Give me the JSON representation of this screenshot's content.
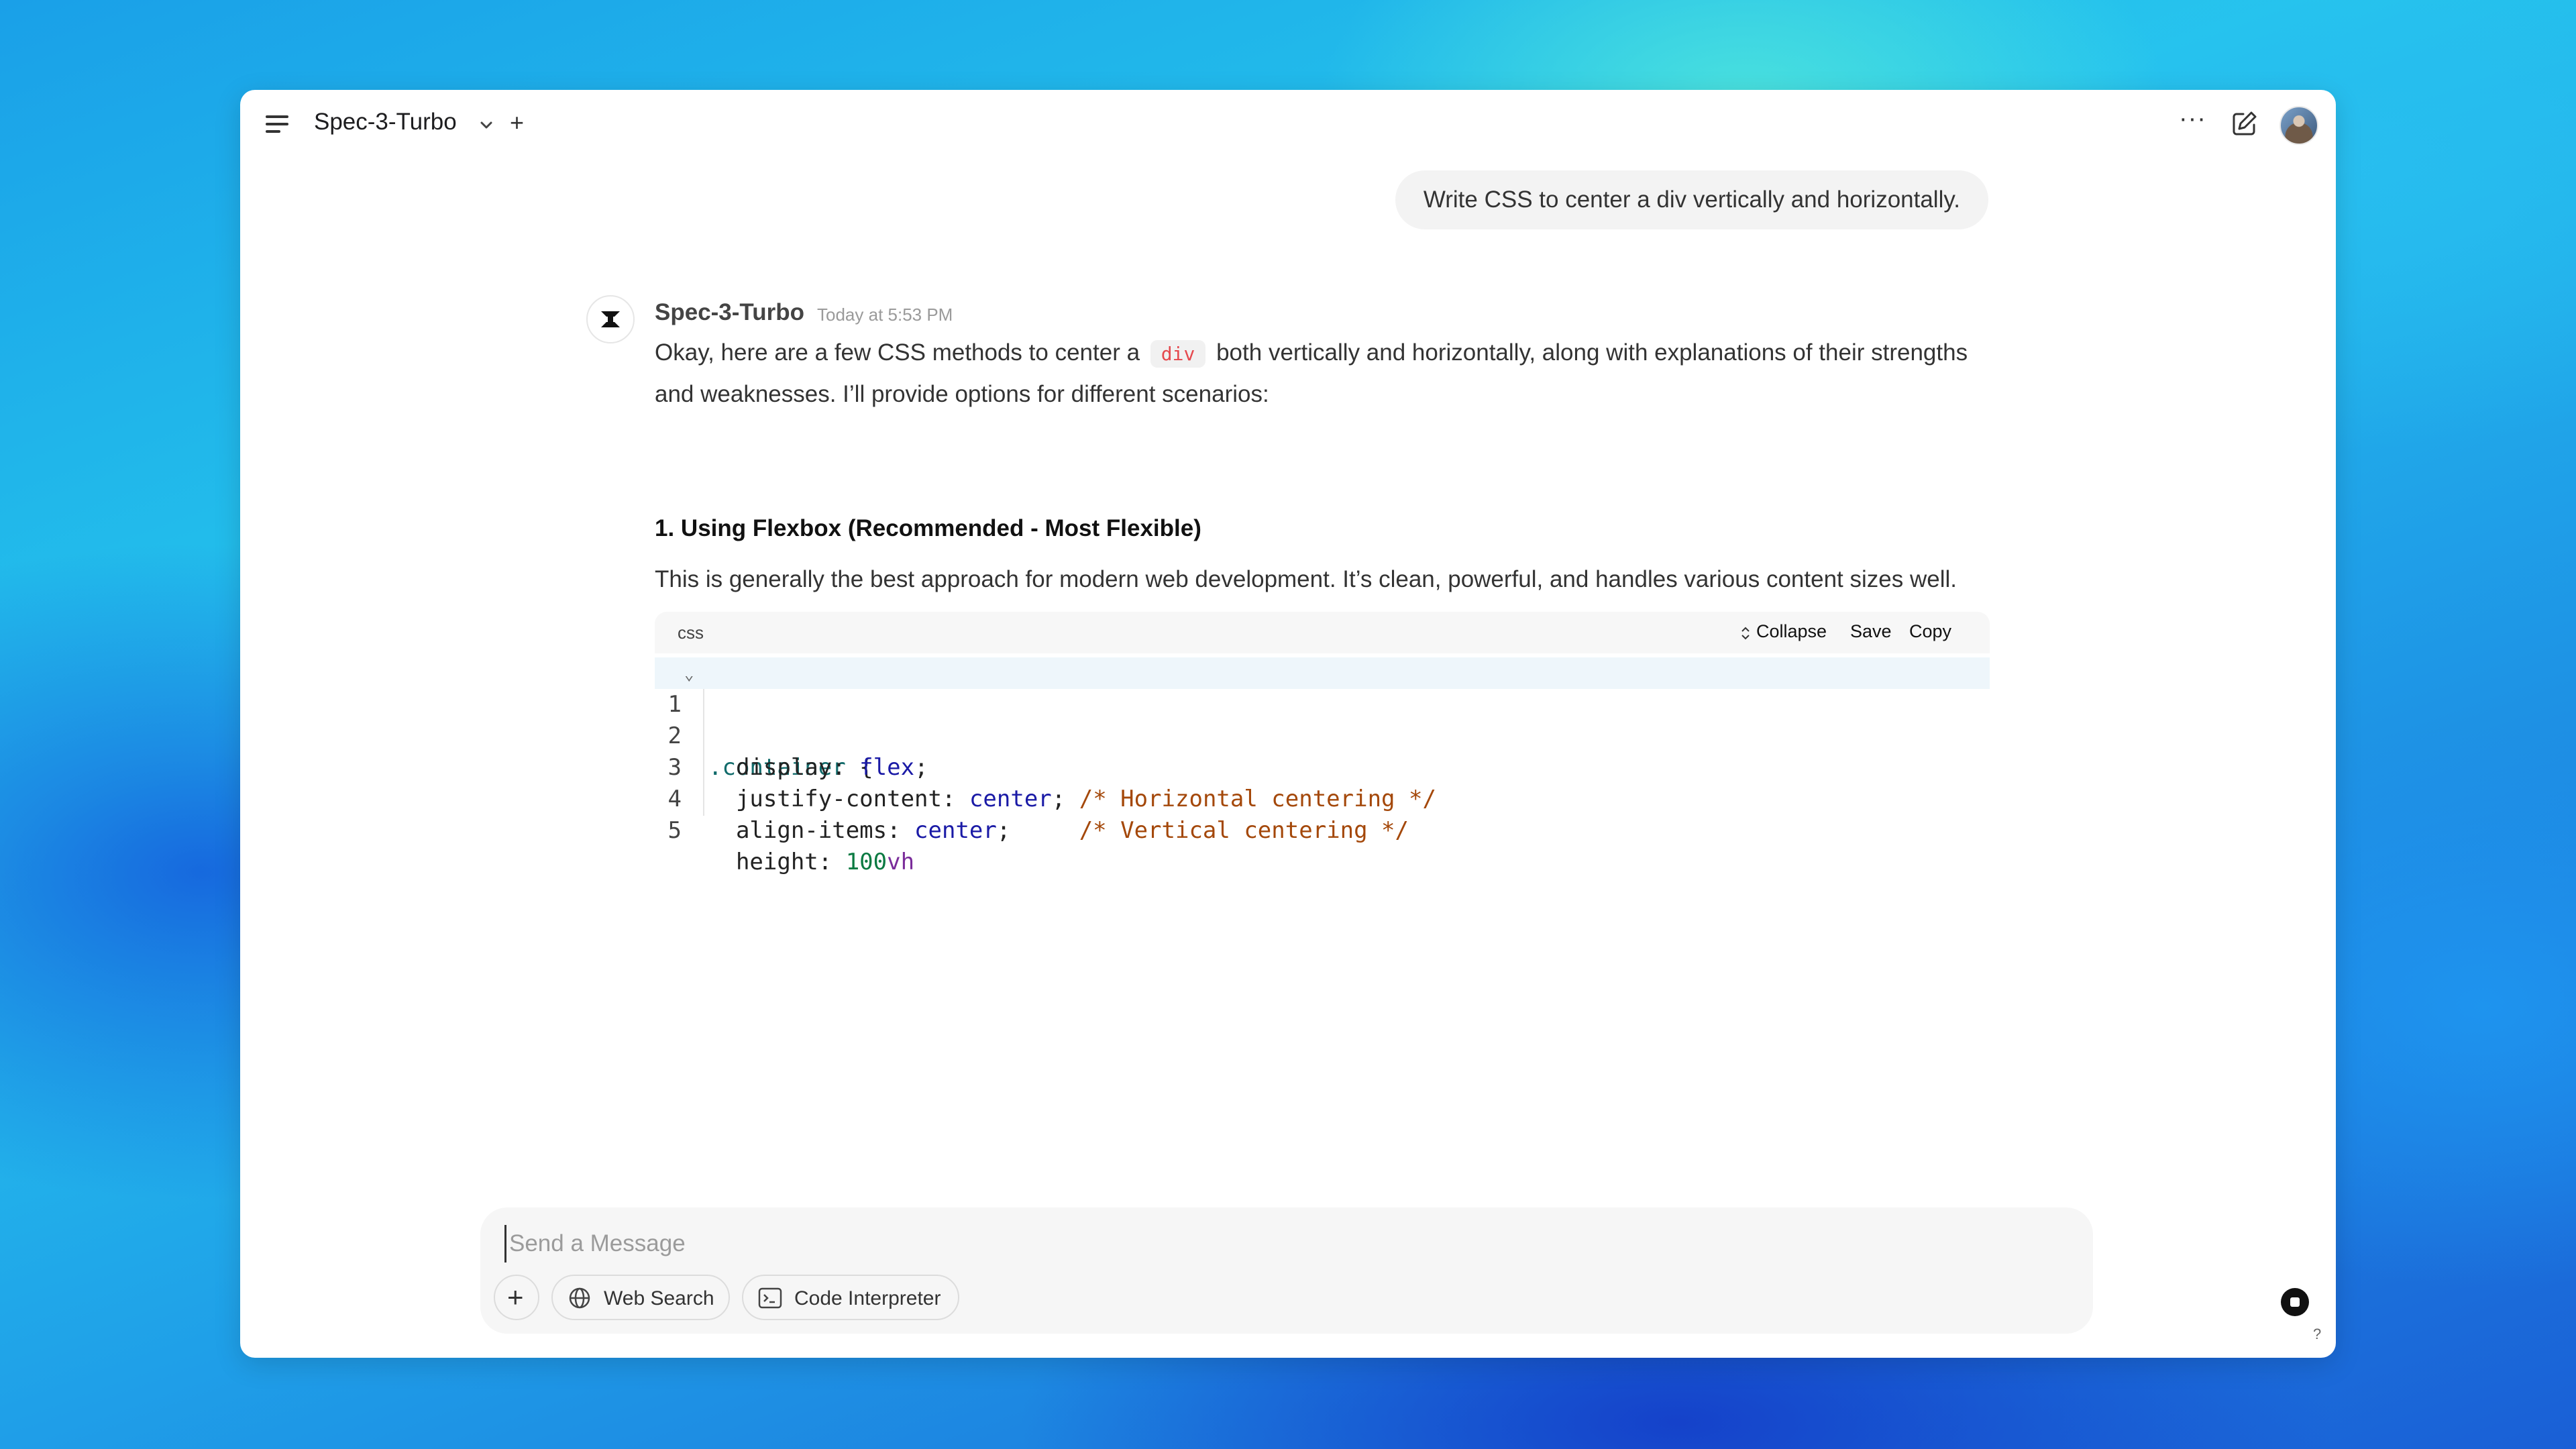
{
  "header": {
    "model_name": "Spec-3-Turbo"
  },
  "user_message": "Write CSS to center a div vertically and horizontally.",
  "assistant": {
    "name": "Spec-3-Turbo",
    "timestamp": "Today at 5:53 PM",
    "intro_before": "Okay, here are a few CSS methods to center a",
    "intro_code": "div",
    "intro_after": "both vertically and horizontally, along with explanations of their strengths and weaknesses. I’ll provide options for different scenarios:",
    "heading": "1. Using Flexbox (Recommended - Most Flexible)",
    "paragraph": "This is generally the best approach for modern web development. It’s clean, powerful, and handles various content sizes well.",
    "code_block": {
      "language": "css",
      "collapse_label": "Collapse",
      "save_label": "Save",
      "copy_label": "Copy",
      "line_numbers": [
        "1",
        "2",
        "3",
        "4",
        "5"
      ],
      "lines": {
        "l1_selector": ".container",
        "l1_brace": " {",
        "l2_prop": "  display: ",
        "l2_val": "flex",
        "l2_end": ";",
        "l3_prop": "  justify-content: ",
        "l3_val": "center",
        "l3_mid": "; ",
        "l3_comment": "/* Horizontal centering */",
        "l4_prop": "  align-items: ",
        "l4_val": "center",
        "l4_mid": ";     ",
        "l4_comment": "/* Vertical centering */",
        "l5_prop": "  height: ",
        "l5_num": "100",
        "l5_unit": "vh"
      }
    }
  },
  "composer": {
    "placeholder": "Send a Message",
    "web_search_label": "Web Search",
    "code_interpreter_label": "Code Interpreter"
  },
  "help_label": "?"
}
